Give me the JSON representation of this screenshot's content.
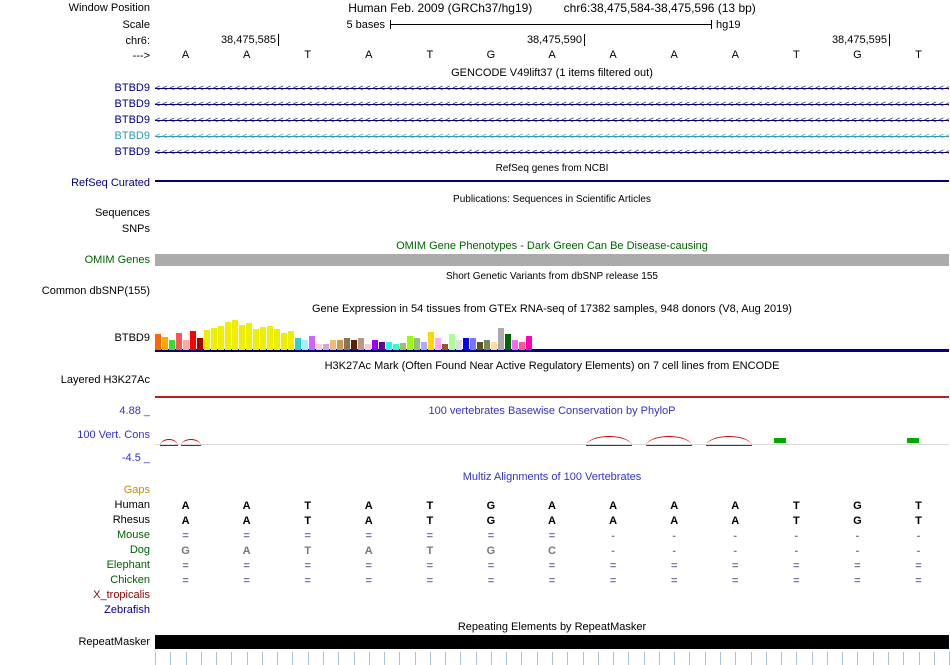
{
  "header": {
    "window_position_label": "Window Position",
    "assembly": "Human Feb. 2009 (GRCh37/hg19)",
    "position": "chr6:38,475,584-38,475,596 (13 bp)",
    "scale_label": "Scale",
    "scale_text": "5 bases",
    "scale_tag": "hg19",
    "chrom_label": "chr6:",
    "strand_label": "--->",
    "coords": [
      "38,475,585",
      "38,475,590",
      "38,475,595"
    ],
    "bases": [
      "A",
      "A",
      "T",
      "A",
      "T",
      "G",
      "A",
      "A",
      "A",
      "A",
      "T",
      "G",
      "T"
    ]
  },
  "tracks": {
    "gencode": {
      "title": "GENCODE V49lift37 (1 items filtered out)",
      "transcripts": [
        {
          "label": "BTBD9",
          "color": "#000080"
        },
        {
          "label": "BTBD9",
          "color": "#000080"
        },
        {
          "label": "BTBD9",
          "color": "#000080"
        },
        {
          "label": "BTBD9",
          "color": "#2E9BB5"
        },
        {
          "label": "BTBD9",
          "color": "#000080"
        }
      ]
    },
    "refseq": {
      "title": "RefSeq genes from NCBI",
      "label": "RefSeq Curated",
      "color": "#000080"
    },
    "publications": {
      "title": "Publications: Sequences in Scientific Articles",
      "labels": [
        "Sequences",
        "SNPs"
      ]
    },
    "omim": {
      "title": "OMIM Gene Phenotypes - Dark Green Can Be Disease-causing",
      "label": "OMIM Genes",
      "bar_color": "#ababab",
      "accent": "#006400"
    },
    "dbsnp": {
      "title": "Short Genetic Variants from dbSNP release 155",
      "label": "Common dbSNP(155)"
    },
    "gtex": {
      "title": "Gene Expression in 54 tissues from GTEx RNA-seq of 17382 samples, 948 donors (V8, Aug 2019)",
      "label": "BTBD9",
      "baseline_color": "#000080",
      "bars": [
        {
          "c": "#FF6600",
          "h": 16
        },
        {
          "c": "#FFAA00",
          "h": 13
        },
        {
          "c": "#33DD33",
          "h": 10
        },
        {
          "c": "#FF5555",
          "h": 17
        },
        {
          "c": "#FFAA99",
          "h": 10
        },
        {
          "c": "#FF0000",
          "h": 19
        },
        {
          "c": "#AA0000",
          "h": 12
        },
        {
          "c": "#EEEE00",
          "h": 20
        },
        {
          "c": "#EEEE00",
          "h": 22
        },
        {
          "c": "#EEEE00",
          "h": 24
        },
        {
          "c": "#EEEE00",
          "h": 28
        },
        {
          "c": "#EEEE00",
          "h": 30
        },
        {
          "c": "#EEEE00",
          "h": 25
        },
        {
          "c": "#EEEE00",
          "h": 27
        },
        {
          "c": "#EEEE00",
          "h": 21
        },
        {
          "c": "#EEEE00",
          "h": 23
        },
        {
          "c": "#EEEE00",
          "h": 24
        },
        {
          "c": "#EEEE00",
          "h": 21
        },
        {
          "c": "#EEEE00",
          "h": 17
        },
        {
          "c": "#EEEE00",
          "h": 19
        },
        {
          "c": "#33CCCC",
          "h": 12
        },
        {
          "c": "#AAEEFF",
          "h": 10
        },
        {
          "c": "#CC66FF",
          "h": 14
        },
        {
          "c": "#FFCCCC",
          "h": 6
        },
        {
          "c": "#CCAADD",
          "h": 6
        },
        {
          "c": "#EEBB77",
          "h": 10
        },
        {
          "c": "#CC9955",
          "h": 10
        },
        {
          "c": "#8B7355",
          "h": 12
        },
        {
          "c": "#552200",
          "h": 10
        },
        {
          "c": "#BB9988",
          "h": 12
        },
        {
          "c": "#FFCCCC",
          "h": 6
        },
        {
          "c": "#9900FF",
          "h": 10
        },
        {
          "c": "#660099",
          "h": 8
        },
        {
          "c": "#22FFDD",
          "h": 8
        },
        {
          "c": "#33FFC9",
          "h": 6
        },
        {
          "c": "#AABB66",
          "h": 7
        },
        {
          "c": "#99FF00",
          "h": 14
        },
        {
          "c": "#99BB88",
          "h": 12
        },
        {
          "c": "#AAAAFF",
          "h": 8
        },
        {
          "c": "#FFD700",
          "h": 18
        },
        {
          "c": "#FFAAFF",
          "h": 12
        },
        {
          "c": "#995522",
          "h": 6
        },
        {
          "c": "#AAFF99",
          "h": 16
        },
        {
          "c": "#DDDDDD",
          "h": 10
        },
        {
          "c": "#0000FF",
          "h": 12
        },
        {
          "c": "#7777FF",
          "h": 12
        },
        {
          "c": "#555522",
          "h": 8
        },
        {
          "c": "#778855",
          "h": 10
        },
        {
          "c": "#FFDD99",
          "h": 8
        },
        {
          "c": "#AAAAAA",
          "h": 22
        },
        {
          "c": "#006600",
          "h": 16
        },
        {
          "c": "#FF66FF",
          "h": 10
        },
        {
          "c": "#FF5599",
          "h": 8
        },
        {
          "c": "#FF00BB",
          "h": 14
        }
      ]
    },
    "h3k27ac": {
      "title": "H3K27Ac Mark (Often Found Near Active Regulatory Elements) on 7 cell lines from ENCODE",
      "label": "Layered H3K27Ac",
      "line_color": "#b22222"
    },
    "phylop": {
      "title": "100 vertebrates Basewise Conservation by PhyloP",
      "label": "100 Vert. Cons",
      "max": "4.88 _",
      "min": "-4.5 _",
      "positive_color": "#00a800",
      "negative_color": "#cc0000"
    },
    "multiz": {
      "title": "Multiz Alignments of 100 Vertebrates",
      "rows": [
        {
          "label": "Gaps",
          "label_color": "#cc8800",
          "letter_color": "#000000",
          "cells": [
            "",
            "",
            "",
            "",
            "",
            "",
            "",
            "",
            "",
            "",
            "",
            "",
            ""
          ]
        },
        {
          "label": "Human",
          "label_color": "#000000",
          "letter_color": "#000000",
          "cells": [
            "A",
            "A",
            "T",
            "A",
            "T",
            "G",
            "A",
            "A",
            "A",
            "A",
            "T",
            "G",
            "T"
          ]
        },
        {
          "label": "Rhesus",
          "label_color": "#000000",
          "letter_color": "#000000",
          "cells": [
            "A",
            "A",
            "T",
            "A",
            "T",
            "G",
            "A",
            "A",
            "A",
            "A",
            "T",
            "G",
            "T"
          ]
        },
        {
          "label": "Mouse",
          "label_color": "#006400",
          "letter_color": "#808080",
          "cells": [
            "=",
            "=",
            "=",
            "=",
            "=",
            "=",
            "=",
            "-",
            "-",
            "-",
            "-",
            "-",
            "-"
          ]
        },
        {
          "label": "Dog",
          "label_color": "#006400",
          "letter_color": "#787878",
          "cells": [
            "G",
            "A",
            "T",
            "A",
            "T",
            "G",
            "C",
            "-",
            "-",
            "-",
            "-",
            "-",
            "-"
          ]
        },
        {
          "label": "Elephant",
          "label_color": "#006400",
          "letter_color": "#808080",
          "cells": [
            "=",
            "=",
            "=",
            "=",
            "=",
            "=",
            "=",
            "=",
            "=",
            "=",
            "=",
            "=",
            "="
          ]
        },
        {
          "label": "Chicken",
          "label_color": "#006400",
          "letter_color": "#808080",
          "cells": [
            "=",
            "=",
            "=",
            "=",
            "=",
            "=",
            "=",
            "=",
            "=",
            "=",
            "=",
            "=",
            "="
          ]
        },
        {
          "label": "X_tropicalis",
          "label_color": "#8B0000",
          "letter_color": "#808080",
          "cells": [
            "",
            "",
            "",
            "",
            "",
            "",
            "",
            "",
            "",
            "",
            "",
            "",
            ""
          ]
        },
        {
          "label": "Zebrafish",
          "label_color": "#00008B",
          "letter_color": "#808080",
          "cells": [
            "",
            "",
            "",
            "",
            "",
            "",
            "",
            "",
            "",
            "",
            "",
            "",
            ""
          ]
        }
      ]
    },
    "repeatmasker": {
      "title": "Repeating Elements by RepeatMasker",
      "label": "RepeatMasker",
      "bar_color": "#000000"
    }
  }
}
